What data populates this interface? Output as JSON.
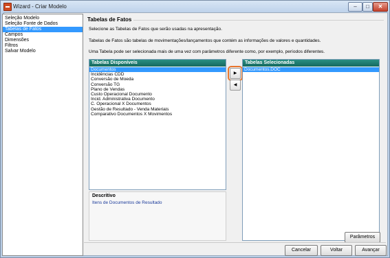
{
  "window": {
    "title": "Wizard - Criar Modelo",
    "minimize": "–",
    "maximize": "□",
    "close": "✕"
  },
  "colors": {
    "selection": "#3399ff",
    "list_header": "#1f7c71",
    "focus_outline": "#e8752c",
    "description_text": "#1a3a9a"
  },
  "icons": {
    "app": "wizard-app-icon",
    "add": "triangle-right-icon",
    "remove": "triangle-left-icon"
  },
  "nav": {
    "items": [
      {
        "label": "Seleção Modelo"
      },
      {
        "label": "Seleção Fonte de Dados"
      },
      {
        "label": "Tabelas de Fatos"
      },
      {
        "label": "Campos"
      },
      {
        "label": "Dimensões"
      },
      {
        "label": "Filtros"
      },
      {
        "label": "Salvar Modelo"
      }
    ],
    "selected_index": 2
  },
  "page": {
    "title": "Tabelas de Fatos",
    "intro1": "Selecione as Tabelas de Fatos que serão usadas na apresentação.",
    "intro2": "Tabelas de Fatos são tabelas de movimentações/lançamentos que contém as informações de valores e quantidades.",
    "intro3": "Uma Tabela pode ser selecionada mais de uma vez com parâmetros diferente como, por exemplo, períodos diferentes."
  },
  "available": {
    "header": "Tabelas Disponíveis",
    "items": [
      "Documentos",
      "Incidências CDD",
      "Conversão de Moeda",
      "Conversão TG",
      "Plano de Vendas",
      "Custo Operacional Documento",
      "Incid. Administrativa Documento",
      "C. Operacional X Documentos",
      "Gestão de Resultado - Venda Materiais",
      "Comparativo Documentos X  Movimentos"
    ],
    "selected_index": 0
  },
  "selected": {
    "header": "Tabelas Selecionadas",
    "items": [
      "Documentos.DOC"
    ],
    "selected_index": 0
  },
  "transfer": {
    "add_glyph": "▶",
    "remove_glyph": "◀"
  },
  "description": {
    "title": "Descritivo",
    "text": "Itens de Documentos de Resultado"
  },
  "buttons": {
    "parametros": "Parâmetros",
    "cancelar": "Cancelar",
    "voltar": "Voltar",
    "avancar": "Avançar"
  }
}
